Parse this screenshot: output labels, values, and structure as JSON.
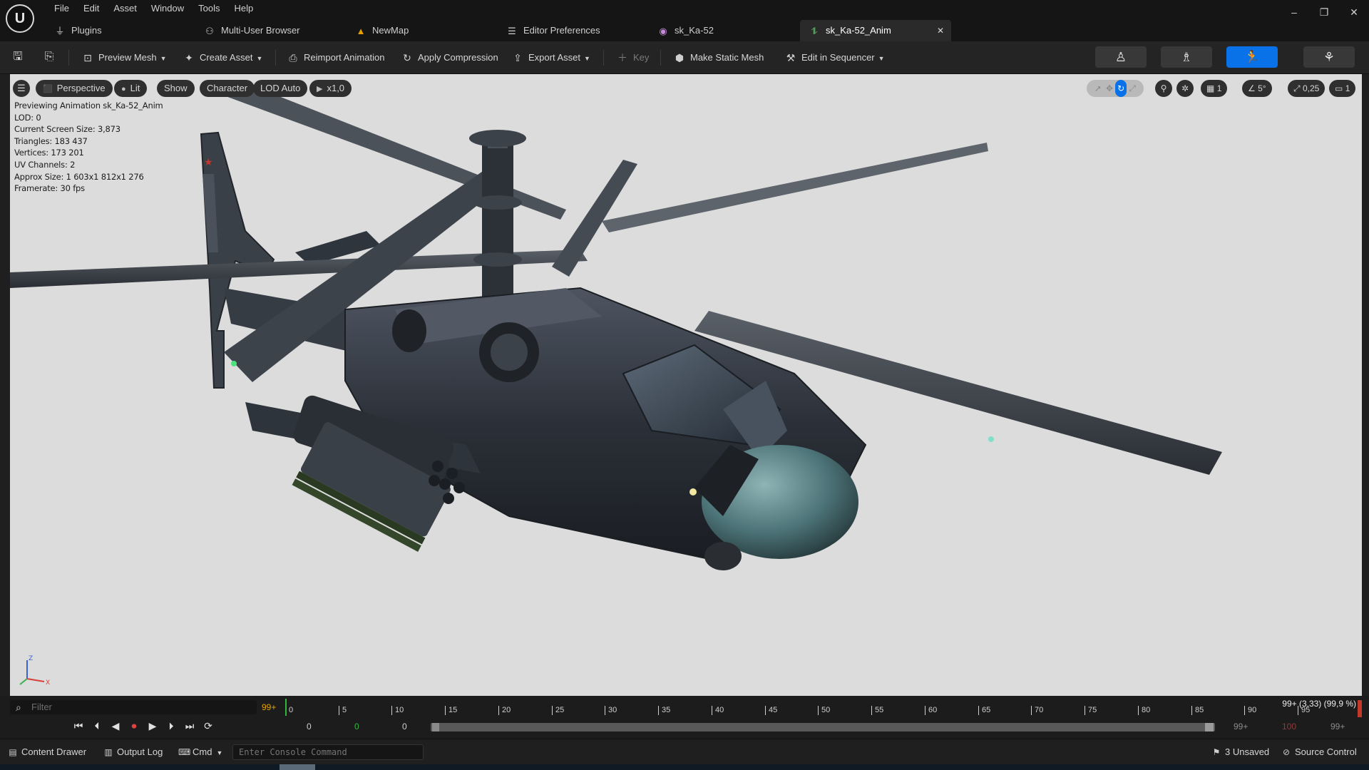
{
  "menu": {
    "items": [
      "File",
      "Edit",
      "Asset",
      "Window",
      "Tools",
      "Help"
    ]
  },
  "window_controls": {
    "minimize": "–",
    "restore": "❐",
    "close": "✕"
  },
  "tabs": [
    {
      "label": "Plugins",
      "icon": "plug-icon"
    },
    {
      "label": "Multi-User Browser",
      "icon": "users-icon"
    },
    {
      "label": "NewMap",
      "icon": "level-icon"
    },
    {
      "label": "Editor Preferences",
      "icon": "sliders-icon"
    },
    {
      "label": "sk_Ka-52",
      "icon": "skeleton-icon"
    },
    {
      "label": "sk_Ka-52_Anim",
      "icon": "animation-icon",
      "active": true
    }
  ],
  "toolbar": {
    "preview_mesh": "Preview Mesh",
    "create_asset": "Create Asset",
    "reimport_animation": "Reimport Animation",
    "apply_compression": "Apply Compression",
    "export_asset": "Export Asset",
    "key": "Key",
    "make_static_mesh": "Make Static Mesh",
    "edit_in_sequencer": "Edit in Sequencer"
  },
  "viewport": {
    "perspective": "Perspective",
    "lit": "Lit",
    "show": "Show",
    "character": "Character",
    "lod": "LOD Auto",
    "play_rate": "x1,0",
    "grid_snap": "1",
    "rotation_snap": "5°",
    "scale_snap": "0,25",
    "camera_speed": "1",
    "stats": [
      "Previewing Animation sk_Ka-52_Anim",
      "LOD: 0",
      "Current Screen Size: 3,873",
      "Triangles: 183 437",
      "Vertices: 173 201",
      "UV Channels: 2",
      "Approx Size: 1 603x1 812x1 276",
      "Framerate: 30 fps"
    ],
    "axis": {
      "x": "X",
      "z": "Z"
    }
  },
  "timeline": {
    "filter_placeholder": "Filter",
    "frame_indicator": "99+",
    "ticks": [
      "0",
      "5",
      "10",
      "15",
      "20",
      "25",
      "30",
      "35",
      "40",
      "45",
      "50",
      "55",
      "60",
      "65",
      "70",
      "75",
      "80",
      "85",
      "90",
      "95"
    ],
    "time_status": "99+ (3,33) (99,9 %)",
    "start_a": "0",
    "start_b": "0",
    "start_c": "0",
    "end_a": "99+",
    "end_red": "100",
    "end_b": "99+"
  },
  "statusbar": {
    "content_drawer": "Content Drawer",
    "output_log": "Output Log",
    "cmd": "Cmd",
    "console_placeholder": "Enter Console Command",
    "unsaved": "3 Unsaved",
    "source_control": "Source Control"
  }
}
